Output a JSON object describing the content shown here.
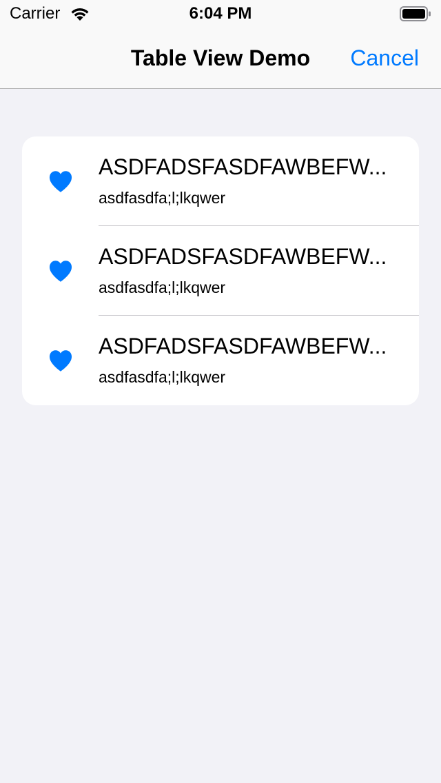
{
  "status_bar": {
    "carrier": "Carrier",
    "time": "6:04 PM"
  },
  "nav_bar": {
    "title": "Table View Demo",
    "cancel_label": "Cancel"
  },
  "colors": {
    "accent": "#007aff",
    "background": "#f2f2f7"
  },
  "table": {
    "rows": [
      {
        "icon": "heart-icon",
        "title": "ASDFADSFASDFAWBEFW...",
        "subtitle": "asdfasdfa;l;lkqwer"
      },
      {
        "icon": "heart-icon",
        "title": "ASDFADSFASDFAWBEFW...",
        "subtitle": "asdfasdfa;l;lkqwer"
      },
      {
        "icon": "heart-icon",
        "title": "ASDFADSFASDFAWBEFW...",
        "subtitle": "asdfasdfa;l;lkqwer"
      }
    ]
  }
}
